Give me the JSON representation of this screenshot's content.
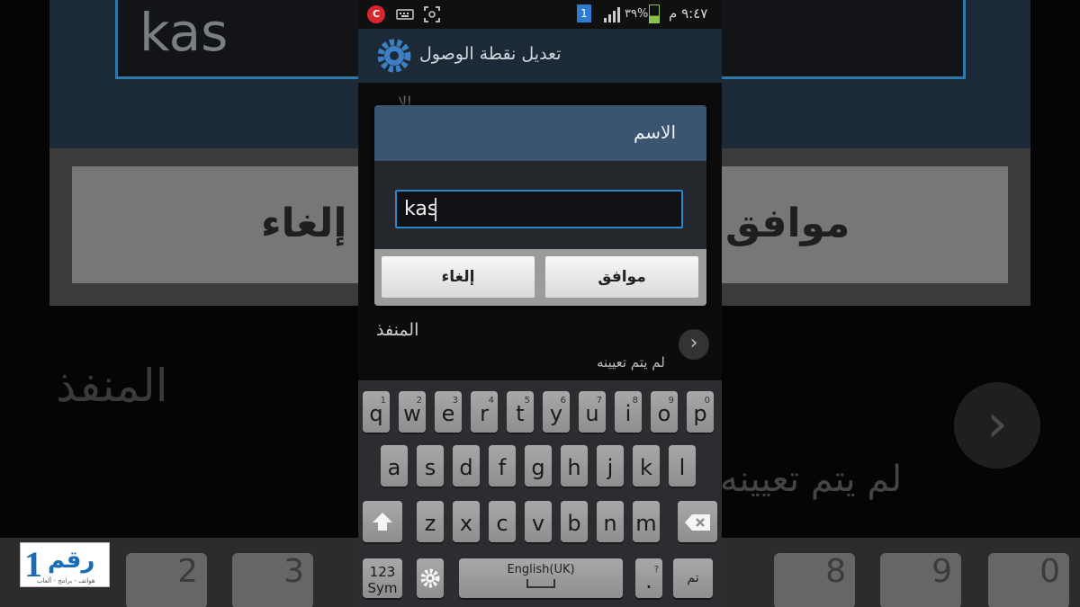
{
  "background": {
    "field_text": "kas",
    "cancel_label": "إلغاء",
    "ok_label": "موافق",
    "port_label": "المنفذ",
    "unset_text": "لم يتم تعيينه",
    "bottom_keys": [
      "2",
      "3",
      "8",
      "9",
      "0"
    ]
  },
  "watermark": {
    "number": "1",
    "word": "رقم",
    "tagline": "هواتف - برامج - ألعاب"
  },
  "statusbar": {
    "notification_badge": "1",
    "battery": "٣٩%",
    "time": "٩:٤٧ م"
  },
  "actionbar": {
    "title": "تعديل نقطة الوصول"
  },
  "list": {
    "peek_text": "الا",
    "port_label": "المنفذ",
    "port_value": "لم يتم تعيينه"
  },
  "dialog": {
    "title": "الاسم",
    "input_value": "kas",
    "cancel_label": "إلغاء",
    "ok_label": "موافق"
  },
  "keyboard": {
    "row1": [
      {
        "k": "q",
        "h": "1"
      },
      {
        "k": "w",
        "h": "2"
      },
      {
        "k": "e",
        "h": "3"
      },
      {
        "k": "r",
        "h": "4"
      },
      {
        "k": "t",
        "h": "5"
      },
      {
        "k": "y",
        "h": "6"
      },
      {
        "k": "u",
        "h": "7"
      },
      {
        "k": "i",
        "h": "8"
      },
      {
        "k": "o",
        "h": "9"
      },
      {
        "k": "p",
        "h": "0"
      }
    ],
    "row2": [
      "a",
      "s",
      "d",
      "f",
      "g",
      "h",
      "j",
      "k",
      "l"
    ],
    "row3": [
      "z",
      "x",
      "c",
      "v",
      "b",
      "n",
      "m"
    ],
    "sym_label": "123\nSym",
    "language": "English(UK)",
    "period": ".",
    "period_hint": "?",
    "done_label": "تم"
  },
  "colors": {
    "accent": "#2c86c7",
    "dialog_header": "#3b5570",
    "actionbar": "#1c2a38"
  }
}
